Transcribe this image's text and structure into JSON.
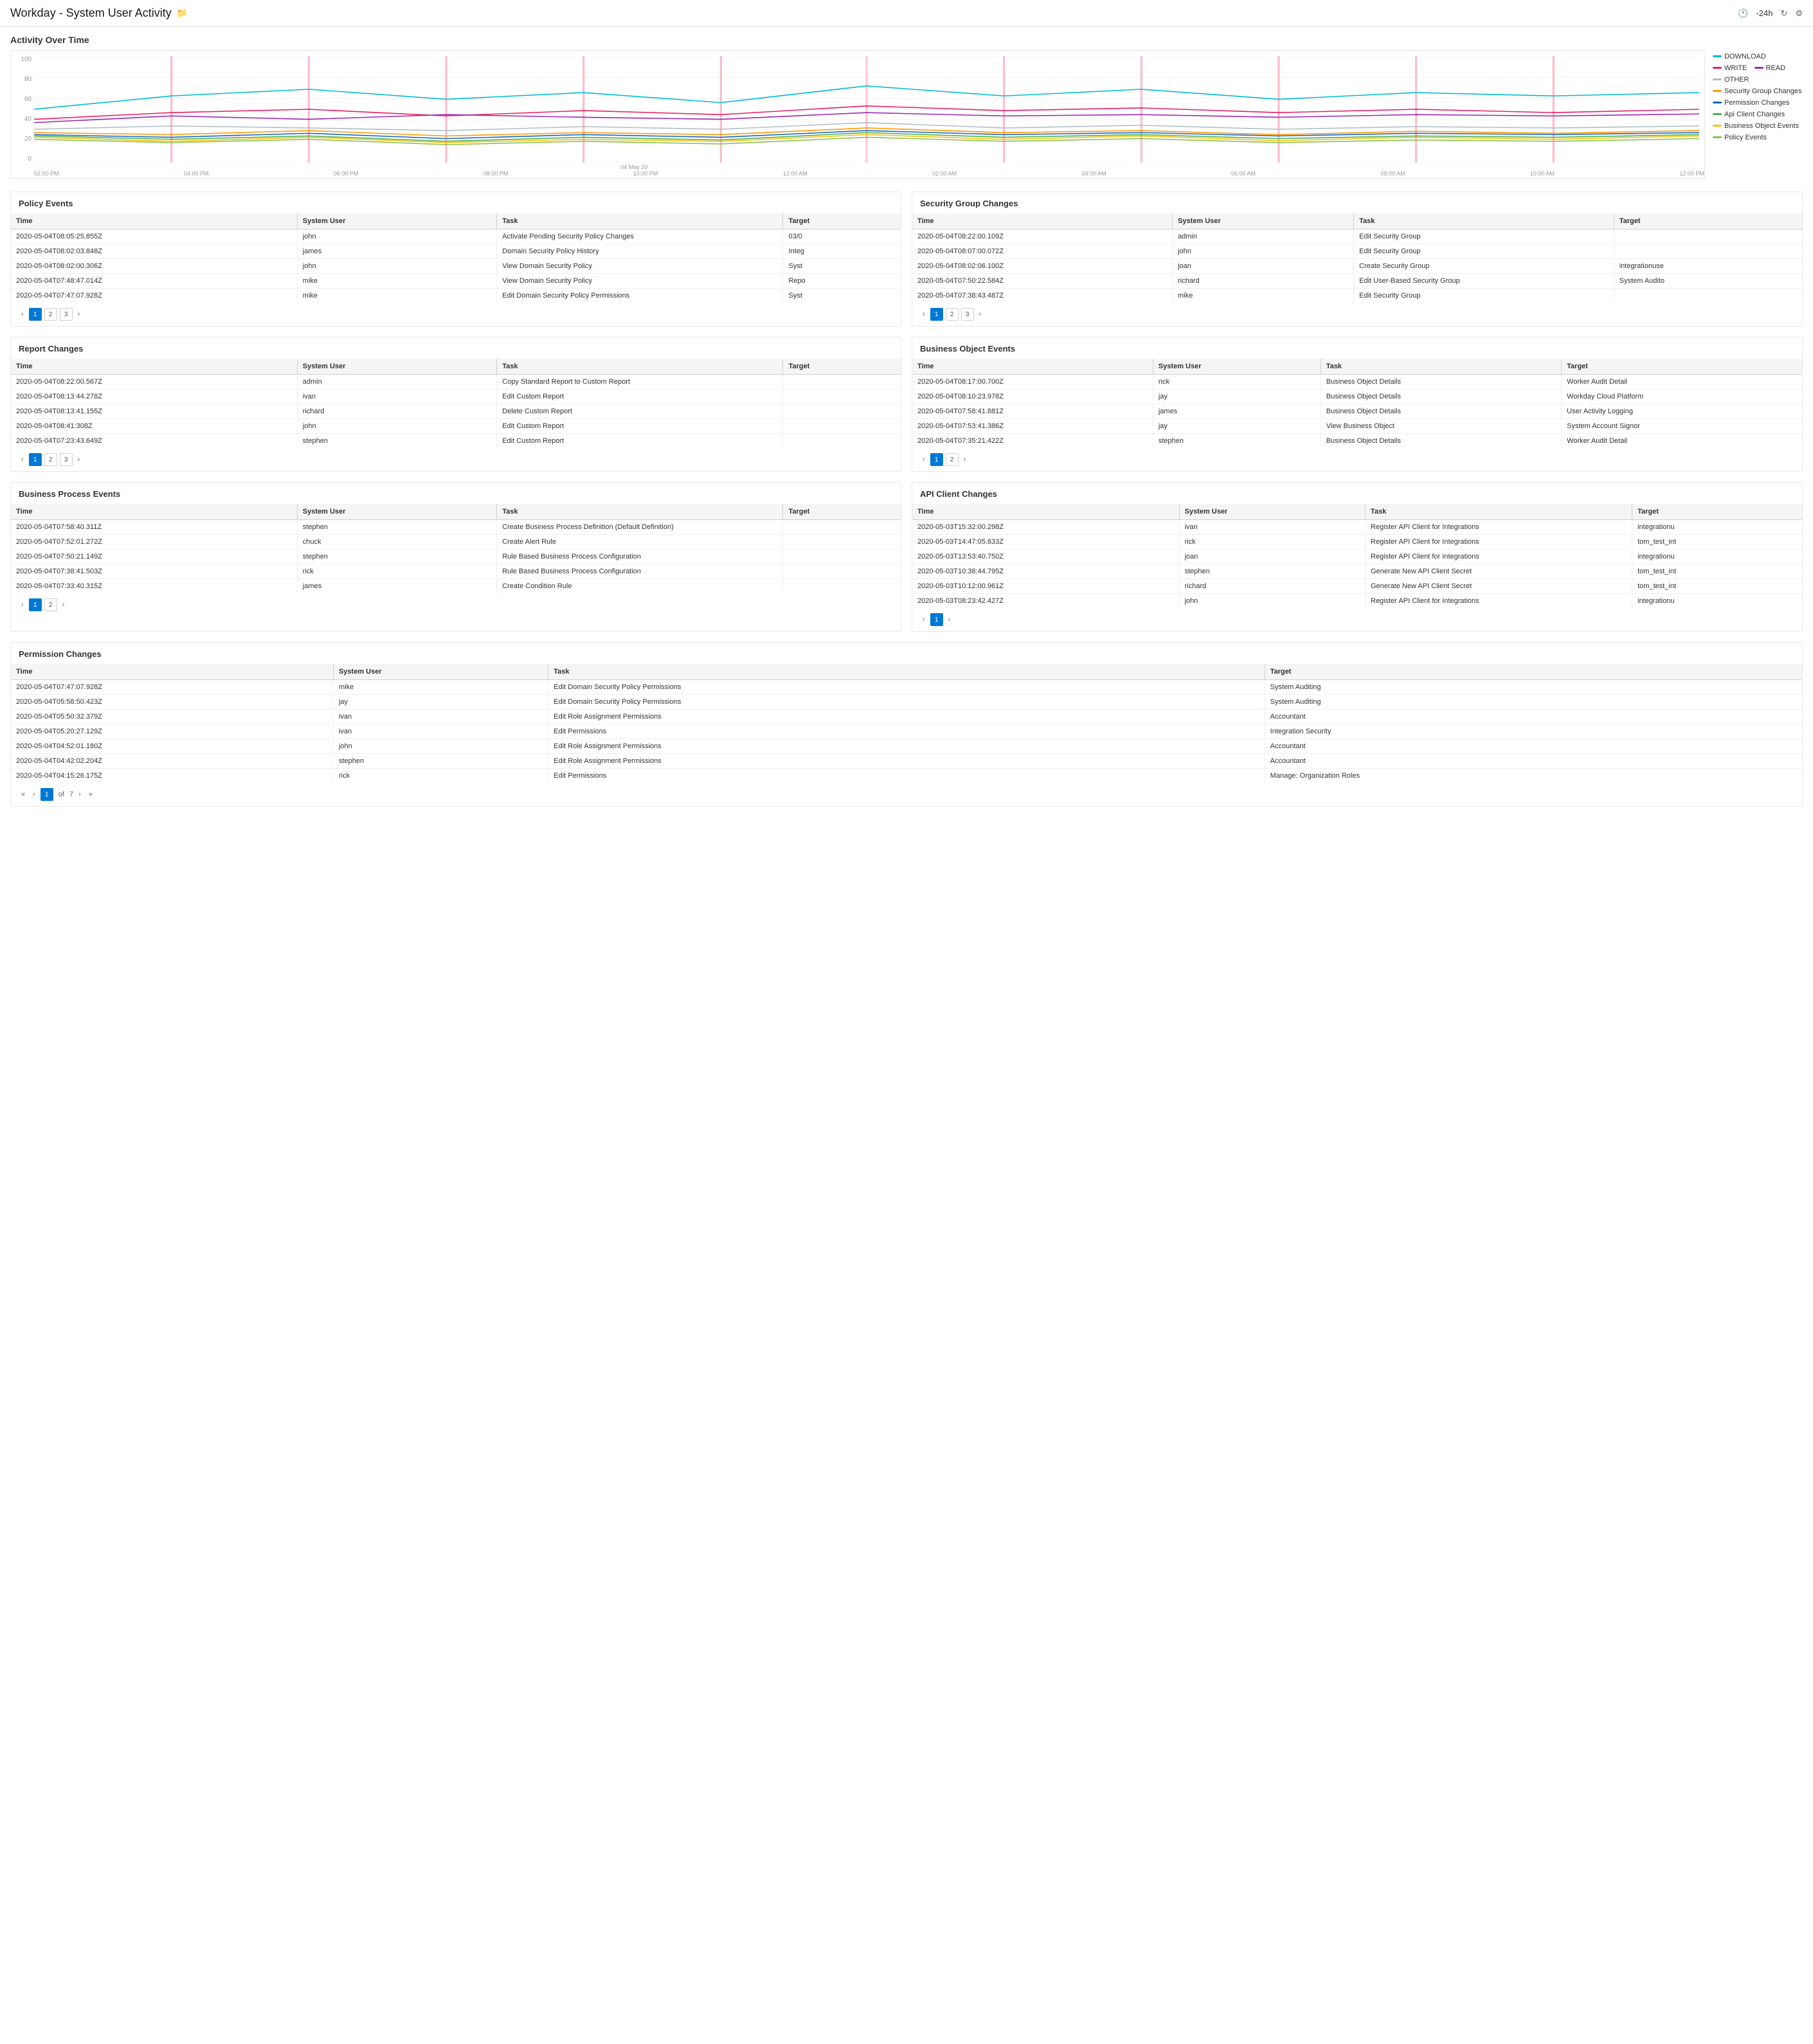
{
  "header": {
    "title": "Workday - System User Activity",
    "time_range": "-24h",
    "folder_icon": "folder-icon",
    "refresh_icon": "refresh-icon",
    "filter_icon": "filter-icon"
  },
  "chart": {
    "title": "Activity Over Time",
    "y_axis": [
      "100",
      "80",
      "60",
      "40",
      "20",
      "0"
    ],
    "x_axis": [
      "02:00 PM",
      "04:00 PM",
      "06:00 PM",
      "08:00 PM",
      "10:00 PM",
      "12:00 AM",
      "02:00 AM",
      "04:00 AM",
      "06:00 AM",
      "08:00 AM",
      "10:00 AM",
      "12:00 PM"
    ],
    "x_date": "04 May 20",
    "legend": [
      {
        "label": "DOWNLOAD",
        "color": "#00bcd4",
        "type": "line"
      },
      {
        "label": "WRITE",
        "color": "#e91e63",
        "type": "line"
      },
      {
        "label": "READ",
        "color": "#9c27b0",
        "type": "line"
      },
      {
        "label": "OTHER",
        "color": "#b0bec5",
        "type": "line"
      },
      {
        "label": "Security Group Changes",
        "color": "#ff9800",
        "type": "line"
      },
      {
        "label": "Permission Changes",
        "color": "#1565c0",
        "type": "line"
      },
      {
        "label": "Api Client Changes",
        "color": "#4caf50",
        "type": "line"
      },
      {
        "label": "Business Object Events",
        "color": "#ffc107",
        "type": "line"
      },
      {
        "label": "Policy Events",
        "color": "#8bc34a",
        "type": "line"
      }
    ]
  },
  "policy_events": {
    "title": "Policy Events",
    "columns": [
      "Time",
      "System User",
      "Task",
      "Target"
    ],
    "rows": [
      [
        "2020-05-04T08:05:25.855Z",
        "john",
        "Activate Pending Security Policy Changes",
        "03/0"
      ],
      [
        "2020-05-04T08:02:03.848Z",
        "james",
        "Domain Security Policy History",
        "Integ"
      ],
      [
        "2020-05-04T08:02:00.306Z",
        "john",
        "View Domain Security Policy",
        "Syst"
      ],
      [
        "2020-05-04T07:48:47.014Z",
        "mike",
        "View Domain Security Policy",
        "Repo"
      ],
      [
        "2020-05-04T07:47:07.928Z",
        "mike",
        "Edit Domain Security Policy Permissions",
        "Syst"
      ]
    ],
    "pagination": {
      "current": 1,
      "total": 3
    }
  },
  "security_group_changes": {
    "title": "Security Group Changes",
    "columns": [
      "Time",
      "System User",
      "Task",
      "Target"
    ],
    "rows": [
      [
        "2020-05-04T08:22:00.109Z",
        "admin",
        "Edit Security Group",
        ""
      ],
      [
        "2020-05-04T08:07:00.072Z",
        "john",
        "Edit Security Group",
        ""
      ],
      [
        "2020-05-04T08:02:06.100Z",
        "joan",
        "Create Security Group",
        "integrationuse"
      ],
      [
        "2020-05-04T07:50:22.584Z",
        "richard",
        "Edit User-Based Security Group",
        "System Audito"
      ],
      [
        "2020-05-04T07:38:43.487Z",
        "mike",
        "Edit Security Group",
        ""
      ]
    ],
    "pagination": {
      "current": 1,
      "total": 3
    }
  },
  "report_changes": {
    "title": "Report Changes",
    "columns": [
      "Time",
      "System User",
      "Task",
      "Target"
    ],
    "rows": [
      [
        "2020-05-04T08:22:00.567Z",
        "admin",
        "Copy Standard Report to Custom Report",
        ""
      ],
      [
        "2020-05-04T08:13:44.278Z",
        "ivan",
        "Edit Custom Report",
        ""
      ],
      [
        "2020-05-04T08:13:41.155Z",
        "richard",
        "Delete Custom Report",
        ""
      ],
      [
        "2020-05-04T08:41:308Z",
        "john",
        "Edit Custom Report",
        ""
      ],
      [
        "2020-05-04T07:23:43.649Z",
        "stephen",
        "Edit Custom Report",
        ""
      ]
    ],
    "pagination": {
      "current": 1,
      "total": 3
    }
  },
  "business_object_events": {
    "title": "Business Object Events",
    "columns": [
      "Time",
      "System User",
      "Task",
      "Target"
    ],
    "rows": [
      [
        "2020-05-04T08:17:00.700Z",
        "rick",
        "Business Object Details",
        "Worker Audit Detail"
      ],
      [
        "2020-05-04T08:10:23.978Z",
        "jay",
        "Business Object Details",
        "Workday Cloud Platform"
      ],
      [
        "2020-05-04T07:58:41.881Z",
        "james",
        "Business Object Details",
        "User Activity Logging"
      ],
      [
        "2020-05-04T07:53:41.386Z",
        "jay",
        "View Business Object",
        "System Account Signor"
      ],
      [
        "2020-05-04T07:35:21.422Z",
        "stephen",
        "Business Object Details",
        "Worker Audit Detail"
      ]
    ],
    "pagination": {
      "current": 1,
      "total": 2
    }
  },
  "business_process_events": {
    "title": "Business Process Events",
    "columns": [
      "Time",
      "System User",
      "Task",
      "Target"
    ],
    "rows": [
      [
        "2020-05-04T07:58:40.311Z",
        "stephen",
        "Create Business Process Definition (Default Definition)",
        ""
      ],
      [
        "2020-05-04T07:52:01.272Z",
        "chuck",
        "Create Alert Rule",
        ""
      ],
      [
        "2020-05-04T07:50:21.149Z",
        "stephen",
        "Rule Based Business Process Configuration",
        ""
      ],
      [
        "2020-05-04T07:38:41.503Z",
        "rick",
        "Rule Based Business Process Configuration",
        ""
      ],
      [
        "2020-05-04T07:33:40.315Z",
        "james",
        "Create Condition Rule",
        ""
      ]
    ],
    "pagination": {
      "current": 1,
      "total": 2
    }
  },
  "api_client_changes": {
    "title": "API Client Changes",
    "columns": [
      "Time",
      "System User",
      "Task",
      "Target"
    ],
    "rows": [
      [
        "2020-05-03T15:32:00.298Z",
        "ivan",
        "Register API Client for Integrations",
        "integrationu"
      ],
      [
        "2020-05-03T14:47:05.833Z",
        "rick",
        "Register API Client for Integrations",
        "tom_test_int"
      ],
      [
        "2020-05-03T13:53:40.750Z",
        "joan",
        "Register API Client for Integrations",
        "integrationu"
      ],
      [
        "2020-05-03T10:38:44.795Z",
        "stephen",
        "Generate New API Client Secret",
        "tom_test_int"
      ],
      [
        "2020-05-03T10:12:00.961Z",
        "richard",
        "Generate New API Client Secret",
        "tom_test_int"
      ],
      [
        "2020-05-03T08:23:42.427Z",
        "john",
        "Register API Client for Integrations",
        "integrationu"
      ]
    ],
    "pagination": {
      "current": 1,
      "total": 1
    }
  },
  "permission_changes": {
    "title": "Permission Changes",
    "columns": [
      "Time",
      "System User",
      "Task",
      "Target"
    ],
    "rows": [
      [
        "2020-05-04T07:47:07.928Z",
        "mike",
        "Edit Domain Security Policy Permissions",
        "System Auditing"
      ],
      [
        "2020-05-04T05:58:50.423Z",
        "jay",
        "Edit Domain Security Policy Permissions",
        "System Auditing"
      ],
      [
        "2020-05-04T05:50:32.379Z",
        "ivan",
        "Edit Role Assignment Permissions",
        "Accountant"
      ],
      [
        "2020-05-04T05:20:27.129Z",
        "ivan",
        "Edit Permissions",
        "Integration Security"
      ],
      [
        "2020-05-04T04:52:01.180Z",
        "john",
        "Edit Role Assignment Permissions",
        "Accountant"
      ],
      [
        "2020-05-04T04:42:02.204Z",
        "stephen",
        "Edit Role Assignment Permissions",
        "Accountant"
      ],
      [
        "2020-05-04T04:15:26.175Z",
        "rick",
        "Edit Permissions",
        "Manage: Organization Roles"
      ]
    ],
    "pagination": {
      "current": 1,
      "total": 7
    }
  }
}
